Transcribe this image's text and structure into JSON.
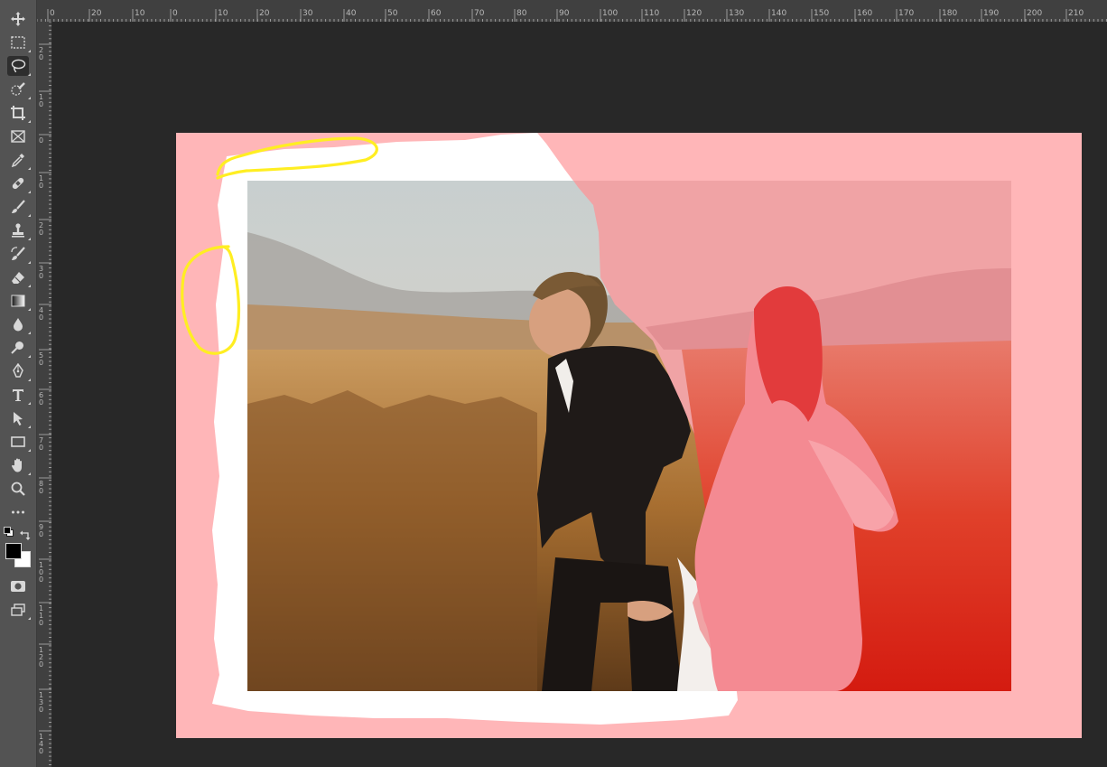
{
  "ruler": {
    "top_labels": [
      "0",
      "20",
      "10",
      "0",
      "10",
      "20",
      "30",
      "40",
      "50",
      "60",
      "70",
      "80",
      "90",
      "100",
      "110",
      "120",
      "130",
      "140",
      "150",
      "160",
      "170",
      "180",
      "190",
      "200",
      "210"
    ],
    "left_labels": [
      "20",
      "10",
      "0",
      "10",
      "20",
      "30",
      "40",
      "50",
      "60",
      "70",
      "80",
      "90",
      "100",
      "110",
      "120",
      "130",
      "140"
    ]
  },
  "tools": [
    {
      "name": "move-tool",
      "icon": "move-icon"
    },
    {
      "name": "rectangular-marquee-tool",
      "icon": "marquee-icon"
    },
    {
      "name": "lasso-tool",
      "icon": "lasso-icon",
      "active": true
    },
    {
      "name": "quick-selection-tool",
      "icon": "quick-selection-icon"
    },
    {
      "name": "crop-tool",
      "icon": "crop-icon"
    },
    {
      "name": "frame-tool",
      "icon": "frame-icon"
    },
    {
      "name": "eyedropper-tool",
      "icon": "eyedropper-icon"
    },
    {
      "name": "spot-healing-tool",
      "icon": "bandage-icon"
    },
    {
      "name": "brush-tool",
      "icon": "brush-icon"
    },
    {
      "name": "clone-stamp-tool",
      "icon": "stamp-icon"
    },
    {
      "name": "history-brush-tool",
      "icon": "history-brush-icon"
    },
    {
      "name": "eraser-tool",
      "icon": "eraser-icon"
    },
    {
      "name": "gradient-tool",
      "icon": "gradient-icon"
    },
    {
      "name": "blur-tool",
      "icon": "blur-drop-icon"
    },
    {
      "name": "dodge-tool",
      "icon": "dodge-icon"
    },
    {
      "name": "pen-tool",
      "icon": "pen-icon"
    },
    {
      "name": "type-tool",
      "icon": "type-icon"
    },
    {
      "name": "path-selection-tool",
      "icon": "arrow-icon"
    },
    {
      "name": "rectangle-tool",
      "icon": "rectangle-icon"
    },
    {
      "name": "hand-tool",
      "icon": "hand-icon"
    },
    {
      "name": "zoom-tool",
      "icon": "zoom-icon"
    },
    {
      "name": "edit-toolbar",
      "icon": "ellipsis-icon"
    }
  ],
  "colors": {
    "foreground": "#000000",
    "background": "#ffffff",
    "quick_mask_overlay": "#ff0000",
    "annotation": "#ffee22"
  }
}
